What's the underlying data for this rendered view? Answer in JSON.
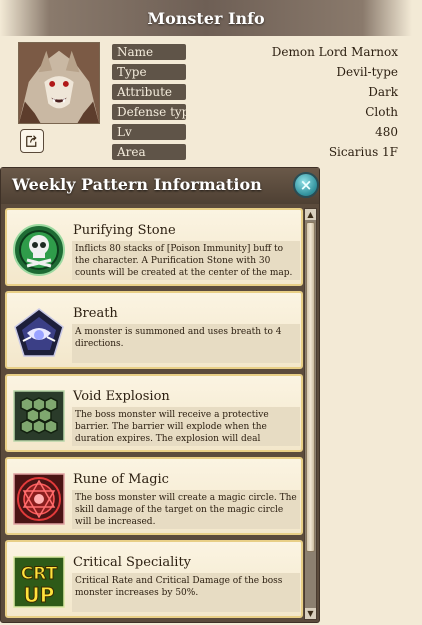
{
  "monster_info": {
    "title": "Monster Info",
    "rows": [
      {
        "label": "Name",
        "value": "Demon Lord Marnox"
      },
      {
        "label": "Type",
        "value": "Devil-type"
      },
      {
        "label": "Attribute",
        "value": "Dark"
      },
      {
        "label": "Defense type",
        "value": "Cloth"
      },
      {
        "label": "Lv",
        "value": "480"
      },
      {
        "label": "Area",
        "value": "Sicarius 1F"
      }
    ]
  },
  "weekly_pattern": {
    "title": "Weekly Pattern Information",
    "close_icon": "×",
    "patterns": [
      {
        "name": "Purifying Stone",
        "desc": "Inflicts 80 stacks of [Poison Immunity] buff to the character. A Purification Stone with 30 counts will be created at the center of the map.",
        "icon": "skull-icon"
      },
      {
        "name": "Breath",
        "desc": "A monster is summoned and uses breath to 4 directions.",
        "icon": "breath-icon"
      },
      {
        "name": "Void Explosion",
        "desc": "The boss monster will receive a protective barrier. The barrier will explode when the duration expires. The explosion will deal",
        "icon": "void-explosion-icon"
      },
      {
        "name": "Rune of Magic",
        "desc": "The boss monster will create a magic circle. The skill damage of the target on the magic circle will be increased.",
        "icon": "rune-icon"
      },
      {
        "name": "Critical Speciality",
        "desc": "Critical Rate and Critical Damage of the boss monster increases by 50%.",
        "icon": "crt-up-icon"
      }
    ],
    "crt_icon_text_top": "CRT",
    "crt_icon_text_bottom": "UP"
  },
  "scroll": {
    "up": "▲",
    "down": "▼"
  }
}
